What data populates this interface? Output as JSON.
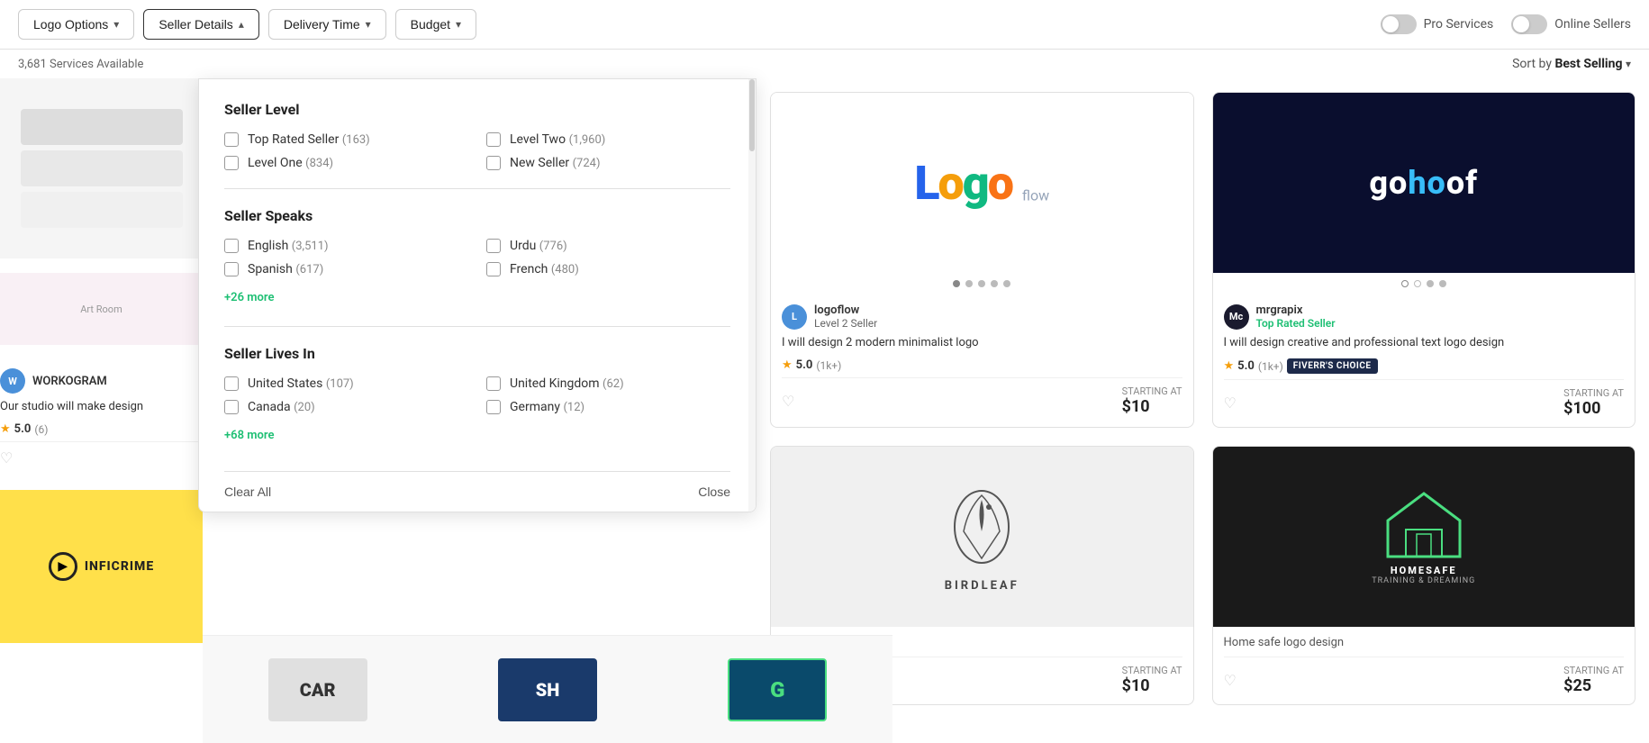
{
  "toolbar": {
    "buttons": [
      {
        "id": "logo-options",
        "label": "Logo Options",
        "chevron": "▾",
        "type": "down"
      },
      {
        "id": "seller-details",
        "label": "Seller Details",
        "chevron": "▴",
        "type": "up"
      },
      {
        "id": "delivery-time",
        "label": "Delivery Time",
        "chevron": "▾",
        "type": "down"
      },
      {
        "id": "budget",
        "label": "Budget",
        "chevron": "▾",
        "type": "down"
      }
    ],
    "toggles": [
      {
        "id": "pro-services",
        "label": "Pro Services",
        "on": false
      },
      {
        "id": "online-sellers",
        "label": "Online Sellers",
        "on": false
      }
    ]
  },
  "subheader": {
    "count": "3,681 Services Available",
    "sort_prefix": "Sort by",
    "sort_value": "Best Selling",
    "sort_chevron": "▾"
  },
  "dropdown": {
    "sections": [
      {
        "id": "seller-level",
        "title": "Seller Level",
        "items": [
          {
            "id": "top-rated",
            "label": "Top Rated Seller",
            "count": "(163)",
            "checked": false
          },
          {
            "id": "level-two",
            "label": "Level Two",
            "count": "(1,960)",
            "checked": false
          },
          {
            "id": "level-one",
            "label": "Level One",
            "count": "(834)",
            "checked": false
          },
          {
            "id": "new-seller",
            "label": "New Seller",
            "count": "(724)",
            "checked": false
          }
        ]
      },
      {
        "id": "seller-speaks",
        "title": "Seller Speaks",
        "items": [
          {
            "id": "english",
            "label": "English",
            "count": "(3,511)",
            "checked": false
          },
          {
            "id": "urdu",
            "label": "Urdu",
            "count": "(776)",
            "checked": false
          },
          {
            "id": "spanish",
            "label": "Spanish",
            "count": "(617)",
            "checked": false
          },
          {
            "id": "french",
            "label": "French",
            "count": "(480)",
            "checked": false
          }
        ],
        "more": "+26 more"
      },
      {
        "id": "seller-lives-in",
        "title": "Seller Lives In",
        "items": [
          {
            "id": "united-states",
            "label": "United States",
            "count": "(107)",
            "checked": false
          },
          {
            "id": "united-kingdom",
            "label": "United Kingdom",
            "count": "(62)",
            "checked": false
          },
          {
            "id": "canada",
            "label": "Canada",
            "count": "(20)",
            "checked": false
          },
          {
            "id": "germany",
            "label": "Germany",
            "count": "(12)",
            "checked": false
          }
        ],
        "more": "+68 more"
      }
    ],
    "footer": {
      "clear_label": "Clear All",
      "close_label": "Close"
    }
  },
  "cards": [
    {
      "id": "logoflow",
      "seller_avatar_initials": "L",
      "seller_avatar_color": "#4a90d9",
      "seller_name": "logoflow",
      "seller_level": "Level 2 Seller",
      "description": "I will design 2 modern minimalist logo",
      "rating": "5.0",
      "rating_count": "(1k+)",
      "badge": null,
      "starting_at": "STARTING AT",
      "price": "$10",
      "dots": 5,
      "active_dot": 0
    },
    {
      "id": "mrgrapix",
      "seller_avatar_initials": "Mc",
      "seller_avatar_color": "#1a1a2e",
      "seller_name": "mrgrapix",
      "seller_level": "Top Rated Seller",
      "description": "I will design creative and professional text logo design",
      "rating": "5.0",
      "rating_count": "(1k+)",
      "badge": "FIVERR'S CHOICE",
      "starting_at": "STARTING AT",
      "price": "$100",
      "dots": 4,
      "active_dot": 0
    }
  ],
  "workogram": {
    "avatar_initials": "W",
    "name": "WORKOGRAM",
    "description": "Our studio will make design",
    "rating": "5.0",
    "rating_count": "(6)"
  },
  "bottom_logos": [
    "CAR",
    "SH",
    "G"
  ]
}
